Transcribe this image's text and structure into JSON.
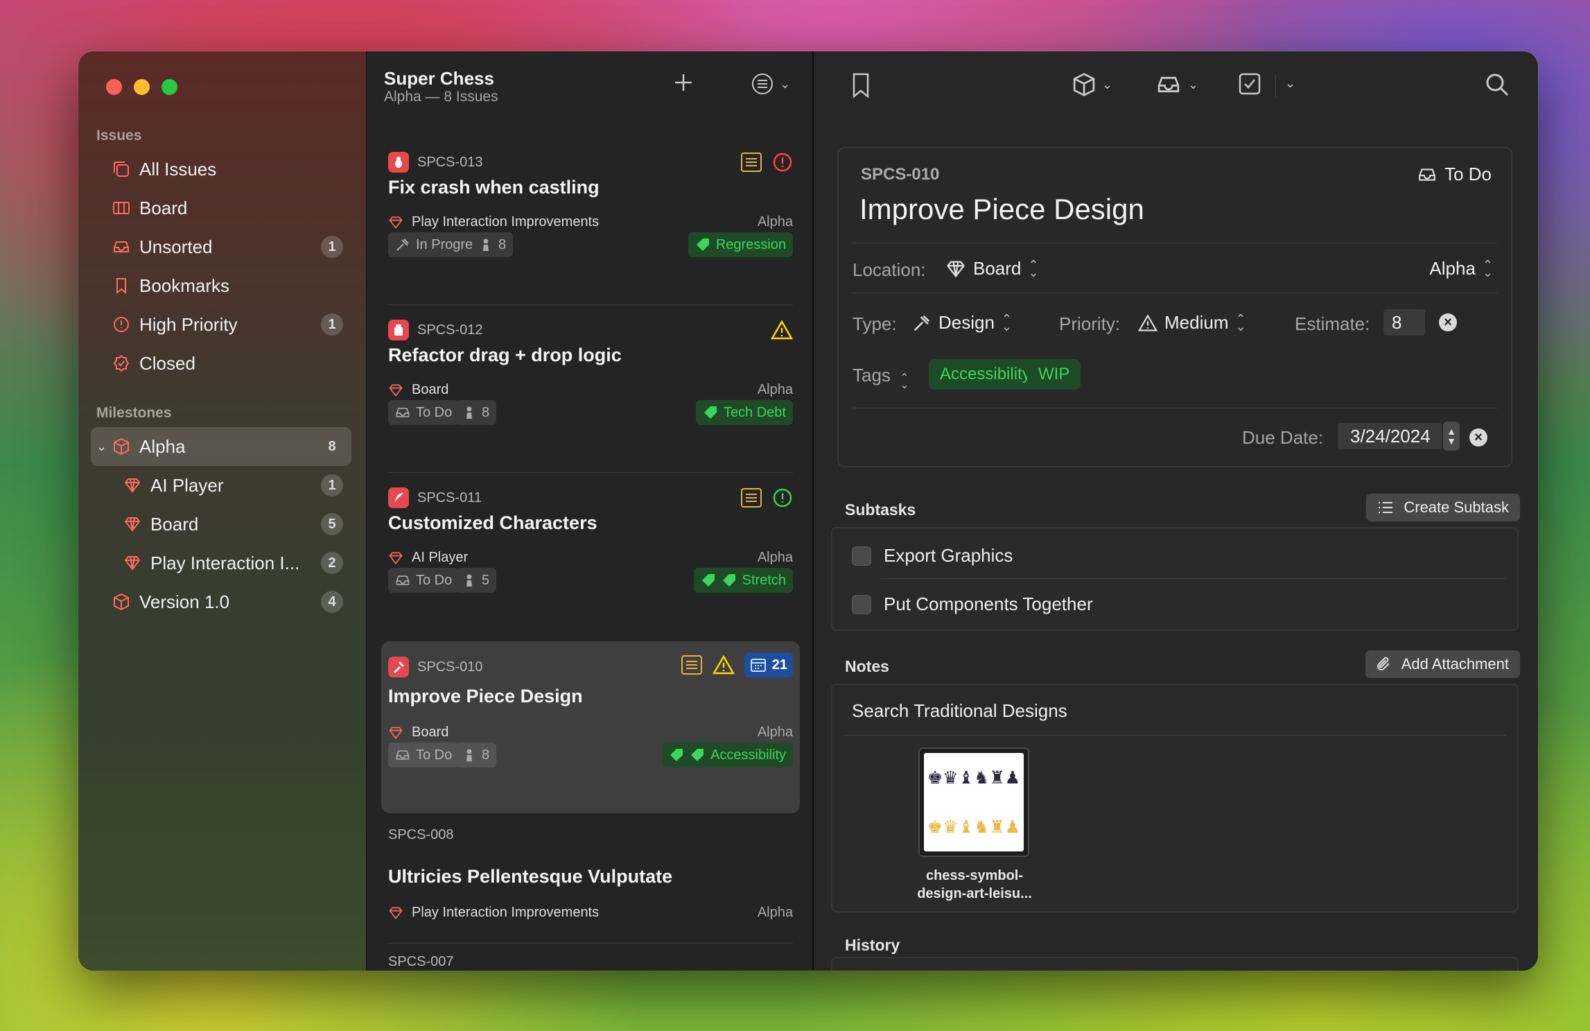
{
  "sidebar": {
    "issues_header": "Issues",
    "items": [
      {
        "label": "All Issues",
        "count": ""
      },
      {
        "label": "Board",
        "count": ""
      },
      {
        "label": "Unsorted",
        "count": "1"
      },
      {
        "label": "Bookmarks",
        "count": ""
      },
      {
        "label": "High Priority",
        "count": "1"
      },
      {
        "label": "Closed",
        "count": ""
      }
    ],
    "milestones_header": "Milestones",
    "milestones": [
      {
        "label": "Alpha",
        "count": "8"
      },
      {
        "label": "AI Player",
        "count": "1"
      },
      {
        "label": "Board",
        "count": "5"
      },
      {
        "label": "Play Interaction I...",
        "count": "2"
      },
      {
        "label": "Version 1.0",
        "count": "4"
      }
    ]
  },
  "list": {
    "title": "Super Chess",
    "subtitle": "Alpha — 8 Issues",
    "cards": [
      {
        "id": "SPCS-013",
        "title": "Fix crash when castling",
        "milestone": "Play Interaction Improvements",
        "release": "Alpha",
        "status": "In Progress",
        "estimate": "8",
        "tag": "Regression"
      },
      {
        "id": "SPCS-012",
        "title": "Refactor drag + drop logic",
        "milestone": "Board",
        "release": "Alpha",
        "status": "To Do",
        "estimate": "8",
        "tag": "Tech Debt"
      },
      {
        "id": "SPCS-011",
        "title": "Customized Characters",
        "milestone": "AI Player",
        "release": "Alpha",
        "status": "To Do",
        "estimate": "5",
        "tag": "Stretch"
      },
      {
        "id": "SPCS-010",
        "title": "Improve Piece Design",
        "milestone": "Board",
        "release": "Alpha",
        "status": "To Do",
        "estimate": "8",
        "tag": "Accessibility",
        "due_days": "21"
      },
      {
        "id": "SPCS-008",
        "title": "Ultricies Pellentesque Vulputate",
        "milestone": "Play Interaction Improvements",
        "release": "Alpha"
      },
      {
        "id": "SPCS-007"
      }
    ]
  },
  "detail": {
    "id": "SPCS-010",
    "status": "To Do",
    "title": "Improve Piece Design",
    "location_label": "Location:",
    "location_value": "Board",
    "release_value": "Alpha",
    "type_label": "Type:",
    "type_value": "Design",
    "priority_label": "Priority:",
    "priority_value": "Medium",
    "estimate_label": "Estimate:",
    "estimate_value": "8",
    "tags_label": "Tags",
    "tags": [
      "Accessibility",
      "WIP"
    ],
    "due_label": "Due Date:",
    "due_value": "3/24/2024",
    "subtasks_header": "Subtasks",
    "create_subtask": "Create Subtask",
    "subtasks": [
      "Export Graphics",
      "Put Components Together"
    ],
    "notes_header": "Notes",
    "add_attachment": "Add Attachment",
    "note_title": "Search Traditional Designs",
    "attachment_name_1": "chess-symbol-",
    "attachment_name_2": "design-art-leisu...",
    "history_header": "History"
  },
  "colors": {
    "accent": "#ff6b5e",
    "tag_green": "#3bd65a",
    "tag_bg": "#1e4a25"
  }
}
